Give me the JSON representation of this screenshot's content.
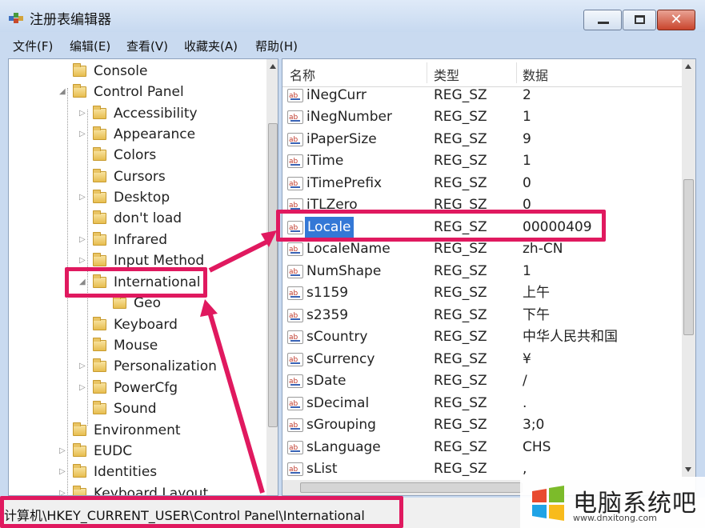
{
  "window": {
    "title": "注册表编辑器",
    "controls": {
      "minimize_icon": "minimize-icon",
      "maximize_icon": "maximize-icon",
      "close_symbol": "✕"
    }
  },
  "menu": [
    "文件(F)",
    "编辑(E)",
    "查看(V)",
    "收藏夹(A)",
    "帮助(H)"
  ],
  "tree": {
    "items": [
      {
        "label": "Console",
        "expander": ""
      },
      {
        "label": "Control Panel",
        "expander": "◢"
      },
      {
        "label": "Accessibility",
        "expander": "▷"
      },
      {
        "label": "Appearance",
        "expander": "▷"
      },
      {
        "label": "Colors",
        "expander": ""
      },
      {
        "label": "Cursors",
        "expander": ""
      },
      {
        "label": "Desktop",
        "expander": "▷"
      },
      {
        "label": "don't load",
        "expander": ""
      },
      {
        "label": "Infrared",
        "expander": "▷"
      },
      {
        "label": "Input Method",
        "expander": "▷"
      },
      {
        "label": "International",
        "expander": "◢"
      },
      {
        "label": "Geo",
        "expander": ""
      },
      {
        "label": "Keyboard",
        "expander": ""
      },
      {
        "label": "Mouse",
        "expander": ""
      },
      {
        "label": "Personalization",
        "expander": "▷"
      },
      {
        "label": "PowerCfg",
        "expander": "▷"
      },
      {
        "label": "Sound",
        "expander": ""
      },
      {
        "label": "Environment",
        "expander": ""
      },
      {
        "label": "EUDC",
        "expander": "▷"
      },
      {
        "label": "Identities",
        "expander": "▷"
      },
      {
        "label": "Keyboard Layout",
        "expander": "▷"
      }
    ],
    "selected": "International"
  },
  "list": {
    "columns": [
      "名称",
      "类型",
      "数据"
    ],
    "rows": [
      {
        "name": "iNegCurr",
        "type": "REG_SZ",
        "data": "2"
      },
      {
        "name": "iNegNumber",
        "type": "REG_SZ",
        "data": "1"
      },
      {
        "name": "iPaperSize",
        "type": "REG_SZ",
        "data": "9"
      },
      {
        "name": "iTime",
        "type": "REG_SZ",
        "data": "1"
      },
      {
        "name": "iTimePrefix",
        "type": "REG_SZ",
        "data": "0"
      },
      {
        "name": "iTLZero",
        "type": "REG_SZ",
        "data": "0"
      },
      {
        "name": "Locale",
        "type": "REG_SZ",
        "data": "00000409"
      },
      {
        "name": "LocaleName",
        "type": "REG_SZ",
        "data": "zh-CN"
      },
      {
        "name": "NumShape",
        "type": "REG_SZ",
        "data": "1"
      },
      {
        "name": "s1159",
        "type": "REG_SZ",
        "data": "上午"
      },
      {
        "name": "s2359",
        "type": "REG_SZ",
        "data": "下午"
      },
      {
        "name": "sCountry",
        "type": "REG_SZ",
        "data": "中华人民共和国"
      },
      {
        "name": "sCurrency",
        "type": "REG_SZ",
        "data": "¥"
      },
      {
        "name": "sDate",
        "type": "REG_SZ",
        "data": "/"
      },
      {
        "name": "sDecimal",
        "type": "REG_SZ",
        "data": "."
      },
      {
        "name": "sGrouping",
        "type": "REG_SZ",
        "data": "3;0"
      },
      {
        "name": "sLanguage",
        "type": "REG_SZ",
        "data": "CHS"
      },
      {
        "name": "sList",
        "type": "REG_SZ",
        "data": ","
      }
    ],
    "selected": "Locale",
    "value_icon_text": "ab"
  },
  "status": {
    "path": "计算机\\HKEY_CURRENT_USER\\Control Panel\\International"
  },
  "watermark": {
    "brand": "电脑系统吧",
    "url": "www.dnxitong.com"
  },
  "colors": {
    "highlight": "#e0195f",
    "selection": "#3478d6"
  }
}
